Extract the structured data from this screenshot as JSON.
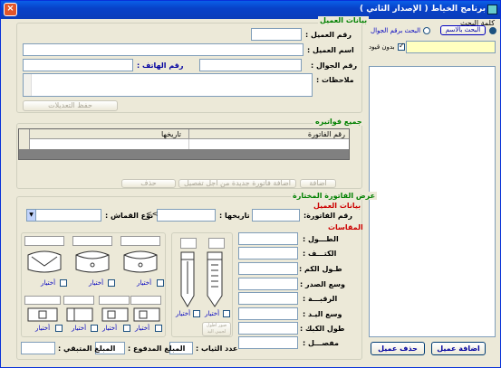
{
  "window": {
    "title": "برنامج الخياط ( الإصدار الثاني )",
    "close": "×"
  },
  "search": {
    "header": "كلمة البحث",
    "by_name": "البحث بالاسم",
    "by_mobile": "البحث برقم الجوال",
    "no_restrict": "بدون قيود",
    "add_button": "اضافة عميل",
    "delete_button": "حذف عميل"
  },
  "customer": {
    "section": "بيانات العميل",
    "number": "رقم العميل :",
    "name": "اسم العميل :",
    "mobile": "رقم الجوال :",
    "phone": "رقم الهاتف :",
    "notes": "ملاحظات :",
    "save": "حفظ التعديلات"
  },
  "invoices": {
    "section": "جميع فواتيره",
    "col_number": "رقم الفاتورة",
    "col_date": "تاريخها",
    "add": "اضافة",
    "add_new": "اضافة فاتورة جديدة من اجل تفصيل",
    "delete": "حذف"
  },
  "selected": {
    "section": "عرض الفاتورة المختارة",
    "cust_data": "بيانات العميل",
    "invoice_no": "رقم الفاتورة:",
    "date": "تاريخها :",
    "fabric_type": "نوع القماش :",
    "nav": "<<",
    "measures": "المقاسات"
  },
  "measures": [
    "الطـــول :",
    "الكتـــف :",
    "طـول الكم :",
    "وسع الصدر :",
    "الرقبـــة :",
    "وسع اليـد :",
    "طول الكبك :",
    "مفصـــل :"
  ],
  "choose": "أختيار",
  "more_images": "صور اطول لجيبي اليد اخرى للفاتورة",
  "totals": {
    "count": "عدد الثياب :",
    "paid": "المبلغ المدفوع :",
    "remaining": "المبلغ المتبقي :"
  }
}
